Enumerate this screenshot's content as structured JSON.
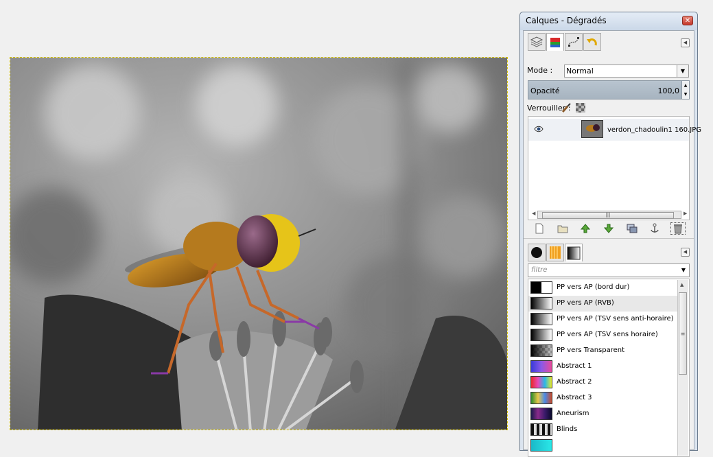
{
  "window": {
    "title": "Calques - Dégradés"
  },
  "layers": {
    "mode_label": "Mode :",
    "mode_value": "Normal",
    "opacity_label": "Opacité",
    "opacity_value": "100,0",
    "lock_label": "Verrouiller :",
    "items": [
      {
        "name": "verdon_chadoulin1 160.JPG",
        "visible": true
      }
    ]
  },
  "gradients": {
    "filter_placeholder": "filtre",
    "selected_index": 1,
    "items": [
      {
        "name": "PP vers AP (bord dur)"
      },
      {
        "name": "PP vers AP (RVB)"
      },
      {
        "name": "PP vers AP (TSV sens anti-horaire)"
      },
      {
        "name": "PP vers AP (TSV sens horaire)"
      },
      {
        "name": "PP vers Transparent"
      },
      {
        "name": "Abstract 1"
      },
      {
        "name": "Abstract 2"
      },
      {
        "name": "Abstract 3"
      },
      {
        "name": "Aneurism"
      },
      {
        "name": "Blinds"
      }
    ]
  },
  "icons": {
    "tabs": [
      "layers-tab-icon",
      "channels-tab-icon",
      "paths-tab-icon",
      "undo-history-tab-icon"
    ],
    "bottom_tabs": [
      "brushes-tab-icon",
      "patterns-tab-icon",
      "gradients-tab-icon"
    ],
    "layer_toolbar": [
      "new-layer-icon",
      "new-layer-group-icon",
      "raise-layer-icon",
      "lower-layer-icon",
      "duplicate-layer-icon",
      "anchor-layer-icon",
      "delete-layer-icon"
    ]
  }
}
